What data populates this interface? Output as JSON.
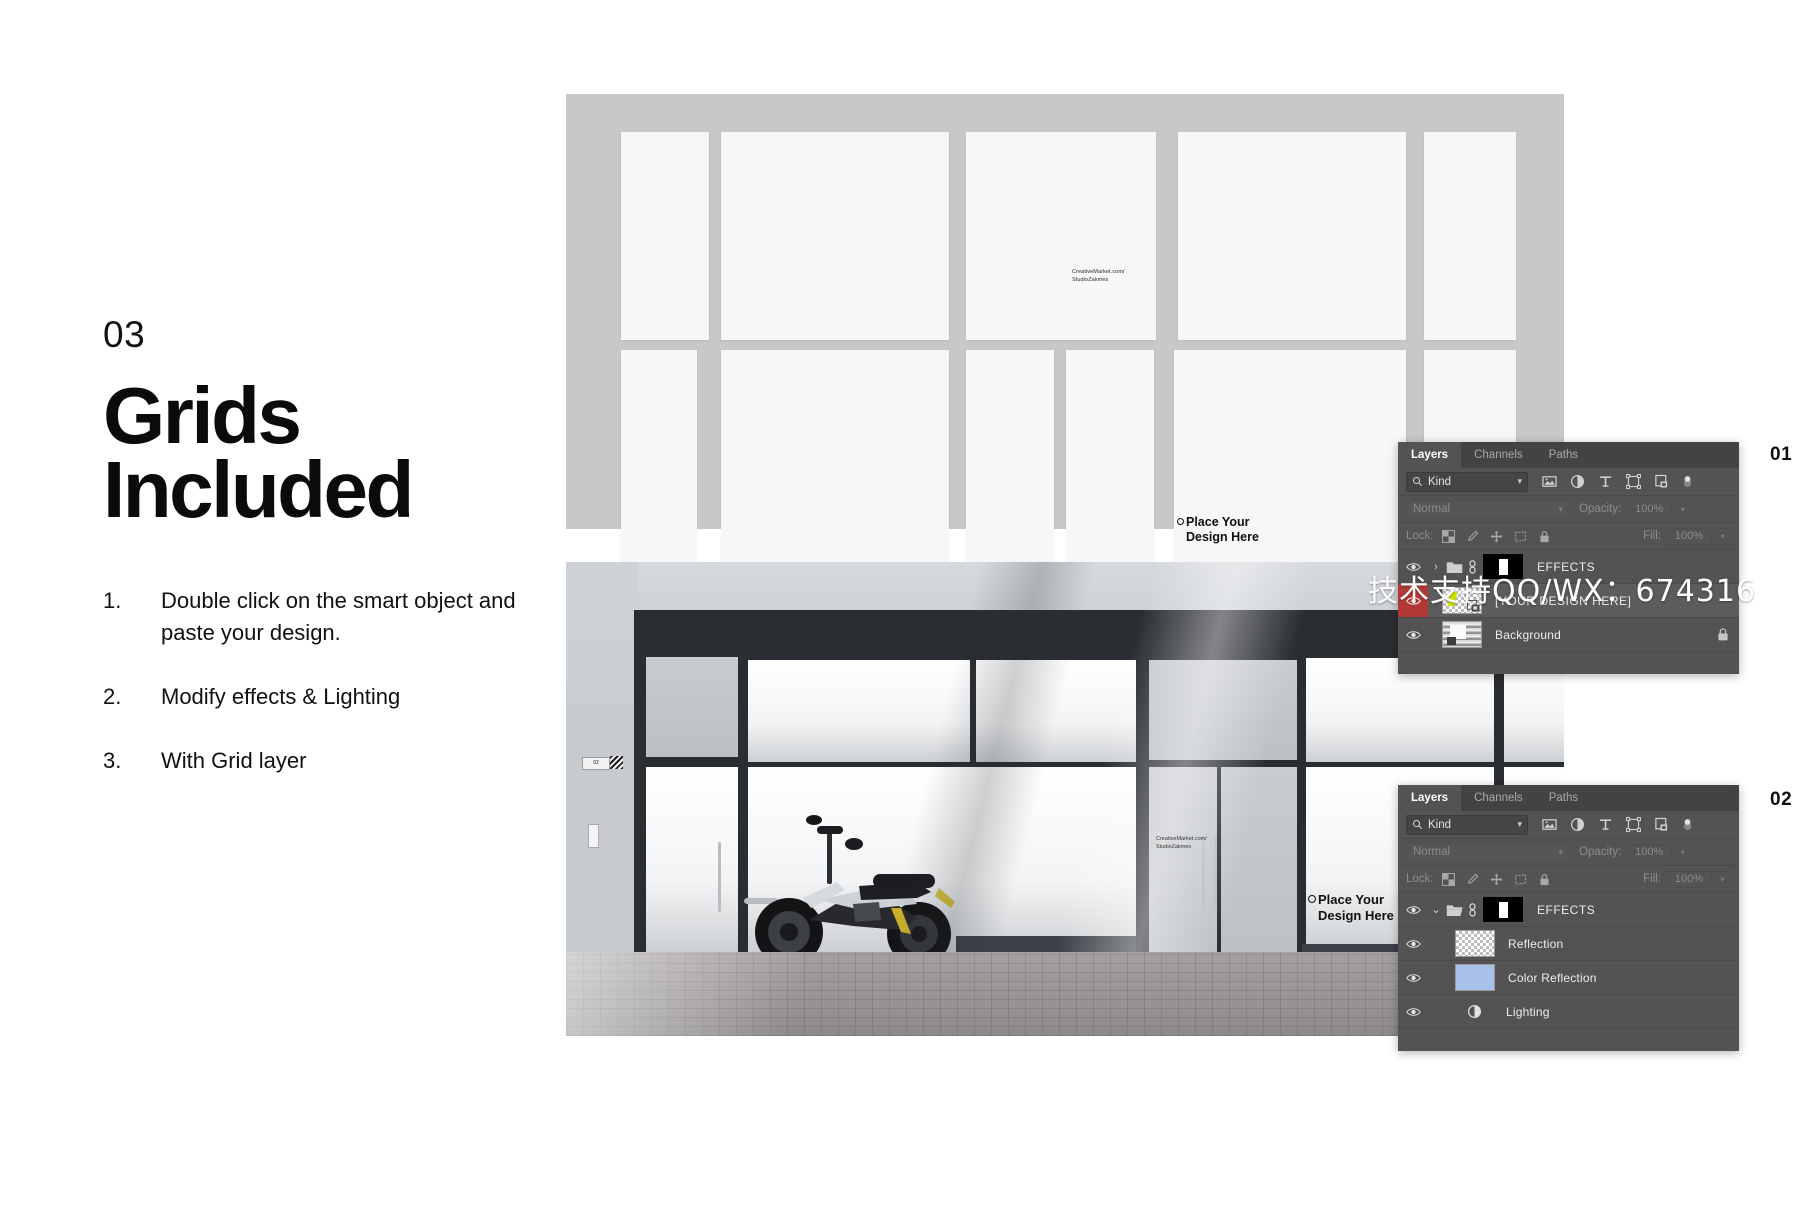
{
  "page": {
    "step_number": "03",
    "headline_line1": "Grids",
    "headline_line2": "Included"
  },
  "instructions": [
    {
      "index": "1.",
      "text": "Double click on the smart object and paste your design."
    },
    {
      "index": "2.",
      "text": "Modify effects & Lighting"
    },
    {
      "index": "3.",
      "text": "With Grid layer"
    }
  ],
  "grid_mockup": {
    "credit": "CreativeMarket.com/\nStudioZakmes",
    "placeholder": "Place Your\nDesign Here"
  },
  "photo_mockup": {
    "credit": "CreativeMarket.com/\nStudioZakmes",
    "placeholder": "Place Your\nDesign Here",
    "door_sign": "02"
  },
  "watermark": {
    "text": "技术支持QQ/WX：674316"
  },
  "panels": [
    {
      "label": "01",
      "tabs": [
        {
          "name": "Layers",
          "active": true
        },
        {
          "name": "Channels",
          "active": false
        },
        {
          "name": "Paths",
          "active": false
        }
      ],
      "filter": {
        "kind_label": "Kind",
        "icons": [
          "image-filter-icon",
          "adjustment-filter-icon",
          "type-filter-icon",
          "shape-filter-icon",
          "smart-object-filter-icon",
          "filter-toggle-switch"
        ]
      },
      "blend": {
        "mode": "Normal",
        "opacity_label": "Opacity:",
        "opacity_value": "100%"
      },
      "lock": {
        "label": "Lock:",
        "fill_label": "Fill:",
        "fill_value": "100%",
        "visible": false
      },
      "layers": [
        {
          "name": "EFFECTS",
          "type": "group",
          "expanded": false,
          "visible": true,
          "selected": false,
          "locked": false,
          "has_mask": true
        },
        {
          "name": "[YOUR DESIGN HERE]",
          "type": "smart-object",
          "visible": true,
          "selected": true,
          "locked": false,
          "has_mask": false
        },
        {
          "name": "Background",
          "type": "image",
          "visible": true,
          "selected": false,
          "locked": true,
          "has_mask": false
        }
      ]
    },
    {
      "label": "02",
      "tabs": [
        {
          "name": "Layers",
          "active": true
        },
        {
          "name": "Channels",
          "active": false
        },
        {
          "name": "Paths",
          "active": false
        }
      ],
      "filter": {
        "kind_label": "Kind",
        "icons": [
          "image-filter-icon",
          "adjustment-filter-icon",
          "type-filter-icon",
          "shape-filter-icon",
          "smart-object-filter-icon",
          "filter-toggle-switch"
        ]
      },
      "blend": {
        "mode": "Normal",
        "opacity_label": "Opacity:",
        "opacity_value": "100%"
      },
      "lock": {
        "label": "Lock:",
        "fill_label": "Fill:",
        "fill_value": "100%",
        "visible": true
      },
      "layers": [
        {
          "name": "EFFECTS",
          "type": "group",
          "expanded": true,
          "visible": true,
          "selected": false,
          "locked": false,
          "has_mask": true
        },
        {
          "name": "Reflection",
          "type": "transparent",
          "visible": true,
          "selected": false,
          "locked": false,
          "has_mask": false
        },
        {
          "name": "Color Reflection",
          "type": "solid",
          "visible": true,
          "selected": false,
          "locked": false,
          "has_mask": false
        },
        {
          "name": "Lighting",
          "type": "adjustment",
          "visible": true,
          "selected": false,
          "locked": false,
          "has_mask": false
        }
      ]
    }
  ],
  "colors": {
    "panel_bg": "#535353",
    "panel_tabbar": "#434343",
    "selected_row": "#5c5c5c",
    "eye_highlight": "#b23a36",
    "grid_bg": "#c8c8c8",
    "grid_cell": "#f7f7f7",
    "color_reflection_swatch": "#a7c1e8"
  }
}
